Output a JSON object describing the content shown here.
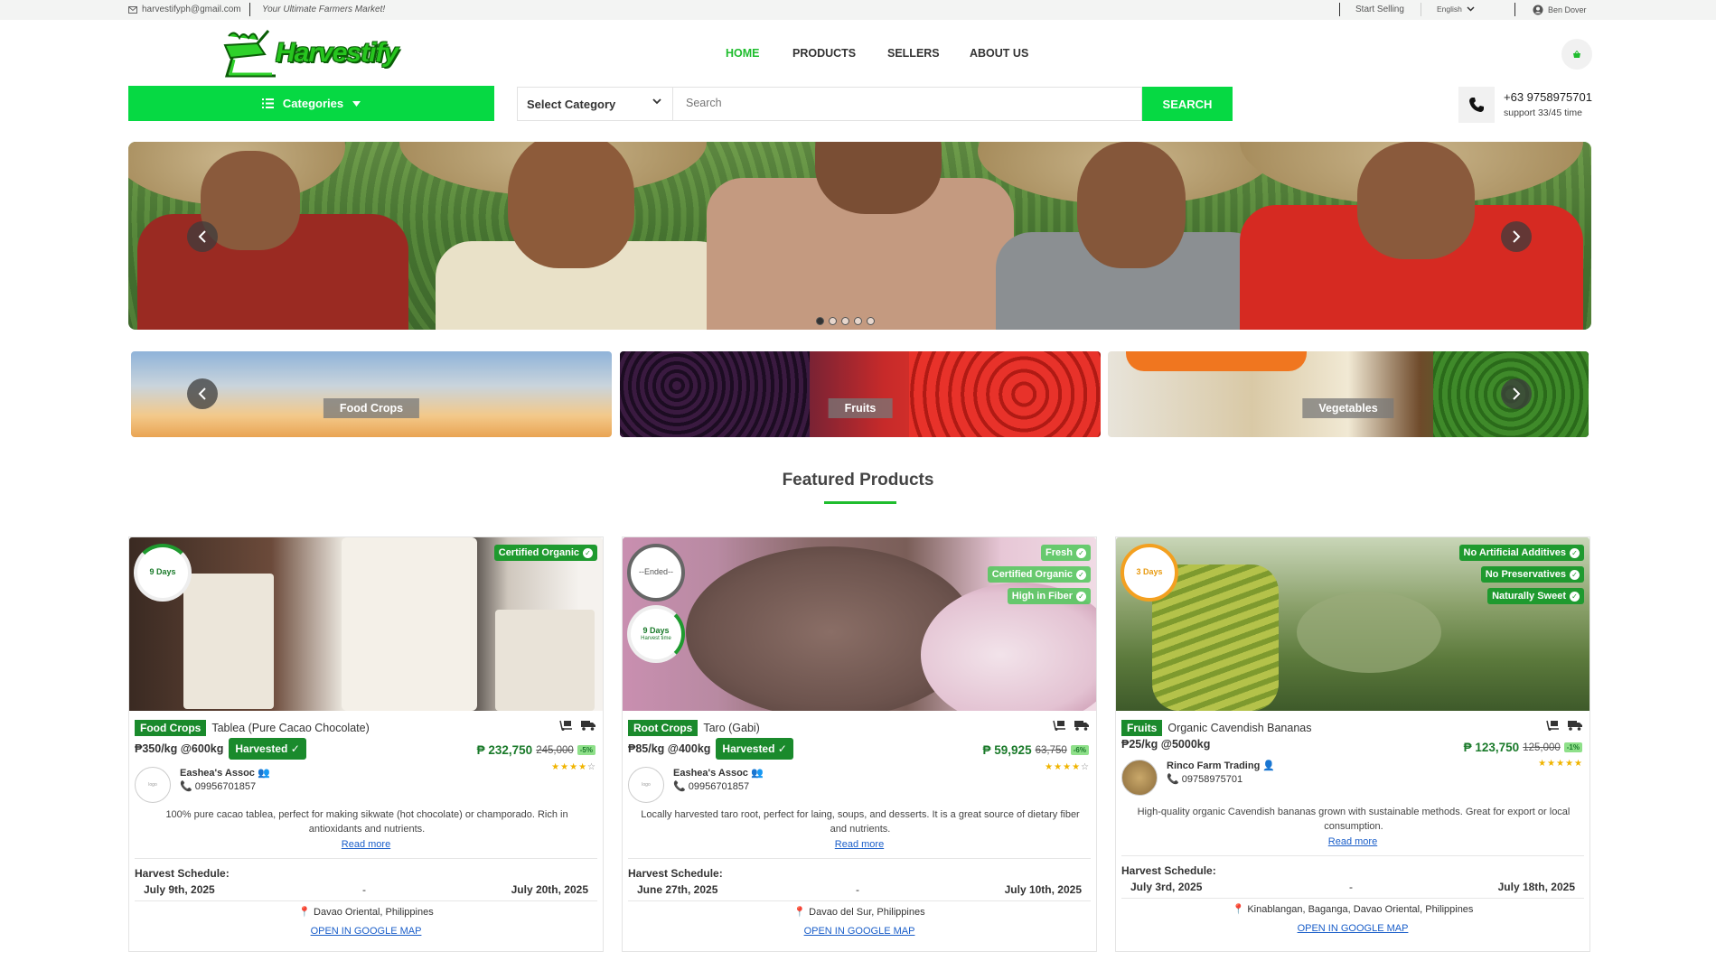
{
  "topbar": {
    "email": "harvestifyph@gmail.com",
    "tagline": "Your Ultimate Farmers Market!",
    "start_selling": "Start Selling",
    "language": "English",
    "user": "Ben Dover"
  },
  "header": {
    "logo_text": "Harvestify",
    "nav": [
      "HOME",
      "PRODUCTS",
      "SELLERS",
      "ABOUT US"
    ],
    "active_nav": "HOME"
  },
  "search_bar": {
    "categories_label": "Categories",
    "select_label": "Select Category",
    "placeholder": "Search",
    "button": "SEARCH",
    "phone": "+63 9758975701",
    "support": "support 33/45 time"
  },
  "hero": {
    "slides": 5,
    "active_slide": 1
  },
  "category_strip": [
    "Food Crops",
    "Fruits",
    "Vegetables"
  ],
  "featured": {
    "title": "Featured Products",
    "products": [
      {
        "timer": "9 Days",
        "badges": [
          "Certified Organic"
        ],
        "category": "Food Crops",
        "name": "Tablea (Pure Cacao Chocolate)",
        "unit": "₱350/kg @600kg",
        "status": "Harvested",
        "price": "₱ 232,750",
        "old_price": "245,000",
        "discount": "-5%",
        "rating": 4,
        "seller": "Eashea's Assoc",
        "phone": "09956701857",
        "description": "100% pure cacao tablea, perfect for making sikwate (hot chocolate) or champorado. Rich in antioxidants and nutrients.",
        "read_more": "Read more",
        "schedule_label": "Harvest Schedule:",
        "from": "July 9th, 2025",
        "to": "July 20th, 2025",
        "location": "Davao Oriental, Philippines",
        "map_link": "OPEN IN GOOGLE MAP"
      },
      {
        "timer": "--Ended--",
        "timer2": "9 Days",
        "timer2_sub": "Harvest time",
        "badges": [
          "Fresh",
          "Certified Organic",
          "High in Fiber"
        ],
        "category": "Root Crops",
        "name": "Taro (Gabi)",
        "unit": "₱85/kg @400kg",
        "status": "Harvested",
        "price": "₱ 59,925",
        "old_price": "63,750",
        "discount": "-6%",
        "rating": 4,
        "seller": "Eashea's Assoc",
        "phone": "09956701857",
        "description": "Locally harvested taro root, perfect for laing, soups, and desserts. It is a great source of dietary fiber and nutrients.",
        "read_more": "Read more",
        "schedule_label": "Harvest Schedule:",
        "from": "June 27th, 2025",
        "to": "July 10th, 2025",
        "location": "Davao del Sur, Philippines",
        "map_link": "OPEN IN GOOGLE MAP"
      },
      {
        "timer": "3 Days",
        "badges": [
          "No Artificial Additives",
          "No Preservatives",
          "Naturally Sweet"
        ],
        "category": "Fruits",
        "name": "Organic Cavendish Bananas",
        "unit": "₱25/kg @5000kg",
        "status": "",
        "price": "₱ 123,750",
        "old_price": "125,000",
        "discount": "-1%",
        "rating": 5,
        "seller": "Rinco Farm Trading",
        "phone": "09758975701",
        "description": "High-quality organic Cavendish bananas grown with sustainable methods. Great for export or local consumption.",
        "read_more": "Read more",
        "schedule_label": "Harvest Schedule:",
        "from": "July 3rd, 2025",
        "to": "July 18th, 2025",
        "location": "Kinablangan, Baganga, Davao Oriental, Philippines",
        "map_link": "OPEN IN GOOGLE MAP"
      }
    ]
  },
  "colors": {
    "brand_green": "#06d943",
    "dark_green": "#1a8a2c",
    "link": "#1a5ec9"
  }
}
